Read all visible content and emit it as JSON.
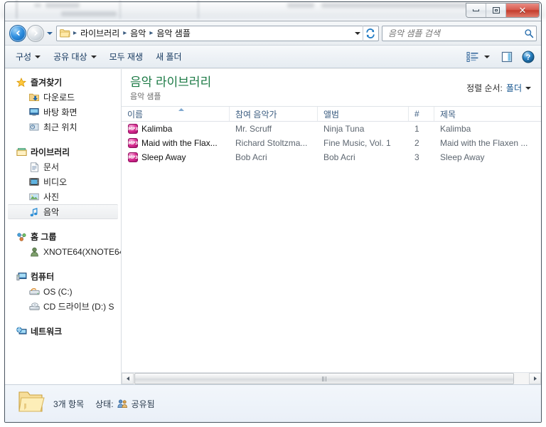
{
  "window": {
    "controls": {
      "minimize_label": "최소화",
      "maximize_label": "이전 크기로 복원",
      "close_label": "닫기",
      "close_glyph": "✕"
    }
  },
  "navbar": {
    "back_label": "뒤로",
    "forward_label": "앞으로",
    "recent_locations_label": "최근 위치",
    "folder_icon": "folder-icon",
    "breadcrumbs": [
      "라이브러리",
      "음악",
      "음악 샘플"
    ],
    "separator": "▸",
    "dropdown_label": "이전 위치",
    "refresh_label": "새로 고침",
    "search": {
      "placeholder": "음악 샘플 검색",
      "value": "",
      "icon": "search-icon"
    }
  },
  "toolbar": {
    "items": [
      {
        "label": "구성",
        "has_caret": true
      },
      {
        "label": "공유 대상",
        "has_caret": true
      },
      {
        "label": "모두 재생",
        "has_caret": false
      },
      {
        "label": "새 폴더",
        "has_caret": false
      }
    ],
    "view_button_label": "보기 변경",
    "view_caret_label": "보기 옵션",
    "preview_pane_label": "미리 보기 창",
    "help_label": "도움말",
    "help_glyph": "?"
  },
  "navpane": {
    "groups": [
      {
        "head": {
          "label": "즐겨찾기",
          "icon": "star-icon"
        },
        "children": [
          {
            "label": "다운로드",
            "icon": "download-folder-icon"
          },
          {
            "label": "바탕 화면",
            "icon": "desktop-icon"
          },
          {
            "label": "최근 위치",
            "icon": "recent-places-icon"
          }
        ]
      },
      {
        "head": {
          "label": "라이브러리",
          "icon": "library-icon"
        },
        "children": [
          {
            "label": "문서",
            "icon": "documents-icon",
            "selected": false
          },
          {
            "label": "비디오",
            "icon": "videos-icon",
            "selected": false
          },
          {
            "label": "사진",
            "icon": "pictures-icon",
            "selected": false
          },
          {
            "label": "음악",
            "icon": "music-note-icon",
            "selected": true
          }
        ]
      },
      {
        "head": {
          "label": "홈 그룹",
          "icon": "homegroup-icon"
        },
        "children": [
          {
            "label": "XNOTE64(XNOTE64",
            "icon": "user-icon"
          }
        ]
      },
      {
        "head": {
          "label": "컴퓨터",
          "icon": "computer-icon"
        },
        "children": [
          {
            "label": "OS (C:)",
            "icon": "hard-drive-icon"
          },
          {
            "label": "CD 드라이브 (D:) S",
            "icon": "cd-drive-icon"
          }
        ]
      },
      {
        "head": {
          "label": "네트워크",
          "icon": "network-icon"
        },
        "children": []
      }
    ]
  },
  "library": {
    "title": "음악 라이브러리",
    "subtitle": "음악 샘플",
    "sort_label": "정렬 순서:",
    "sort_value": "폴더"
  },
  "columns": {
    "name": "이름",
    "artist": "참여 음악가",
    "album": "앨범",
    "number": "#",
    "title": "제목",
    "sorted_by": "이름",
    "sort_direction": "ascending"
  },
  "files": [
    {
      "name": "Kalimba",
      "artist": "Mr. Scruff",
      "album": "Ninja Tuna",
      "number": "1",
      "title": "Kalimba",
      "icon": "mp3-file-icon",
      "icon_text": "MP3"
    },
    {
      "name": "Maid with the Flax...",
      "artist": "Richard Stoltzma...",
      "album": "Fine Music, Vol. 1",
      "number": "2",
      "title": "Maid with the Flaxen ...",
      "icon": "mp3-file-icon",
      "icon_text": "MP3"
    },
    {
      "name": "Sleep Away",
      "artist": "Bob Acri",
      "album": "Bob Acri",
      "number": "3",
      "title": "Sleep Away",
      "icon": "mp3-file-icon",
      "icon_text": "MP3"
    }
  ],
  "scrollbar": {
    "left_label": "왼쪽으로 스크롤",
    "right_label": "오른쪽으로 스크롤"
  },
  "statusbar": {
    "folder_icon": "open-folder-icon",
    "item_count": "3개 항목",
    "state_label": "상태:",
    "share_icon": "shared-users-icon",
    "share_value": "공유됨"
  },
  "colors": {
    "library_title": "#1c7a45",
    "accent_blue": "#14548f",
    "close_button": "#c33c2c",
    "mp3_icon": "#d62a8f"
  }
}
